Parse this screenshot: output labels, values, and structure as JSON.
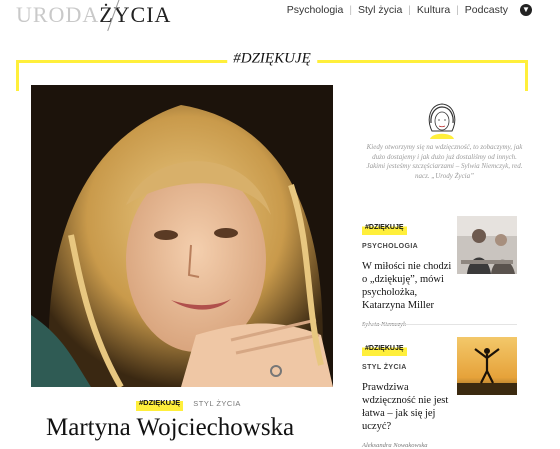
{
  "header": {
    "logo_part1": "URODA",
    "logo_part2": "ŻYCIA",
    "nav": [
      "Psychologia",
      "Styl życia",
      "Kultura",
      "Podcasty"
    ],
    "nav_sep": "|"
  },
  "section": {
    "title": "#DZIĘKUJĘ"
  },
  "hero": {
    "badge": "#DZIĘKUJĘ",
    "category": "STYL ŻYCIA",
    "headline": "Martyna Wojciechowska"
  },
  "quote": {
    "text": "Kiedy otworzymy się na wdzięczność, to zobaczymy, jak dużo dostajemy i jak dużo już dostaliśmy od innych. Jakimi jesteśmy szczęściarzami – Sylwia Niemczyk, red. nacz. „Urody Życia”"
  },
  "cards": [
    {
      "badge": "#DZIĘKUJĘ",
      "category": "PSYCHOLOGIA",
      "title": "W miłości nie chodzi o „dziękuję”, mówi psycholożka, Katarzyna Miller",
      "author": "Sylwia Niemczyk"
    },
    {
      "badge": "#DZIĘKUJĘ",
      "category": "STYL ŻYCIA",
      "title": "Prawdziwa wdzięczność nie jest łatwa – jak się jej uczyć?",
      "author": "Aleksandra Nowakowska"
    }
  ],
  "colors": {
    "accent": "#ffef3b",
    "text": "#111111",
    "muted": "#9a9a9a"
  }
}
